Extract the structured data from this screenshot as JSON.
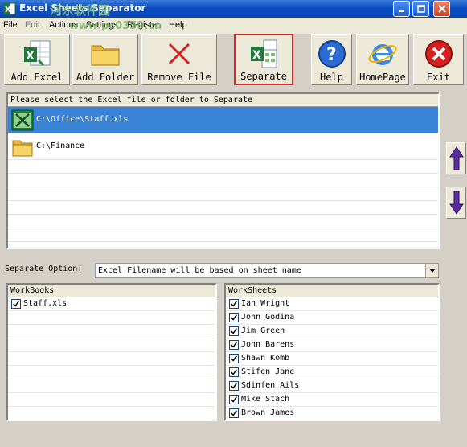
{
  "window": {
    "title": "Excel Sheets Separator"
  },
  "watermark": {
    "text": "www.pc0359.cn"
  },
  "menu": [
    "File",
    "Edit",
    "Actions",
    "Settings",
    "Register",
    "Help"
  ],
  "toolbar": [
    {
      "label": "Add Excel",
      "icon": "add-excel-icon"
    },
    {
      "label": "Add Folder",
      "icon": "folder-icon"
    },
    {
      "label": "Remove File",
      "icon": "remove-x-icon"
    },
    {
      "label": "Separate",
      "icon": "separate-icon"
    },
    {
      "label": "Help",
      "icon": "help-icon"
    },
    {
      "label": "HomePage",
      "icon": "internet-explorer-icon"
    },
    {
      "label": "Exit",
      "icon": "exit-icon"
    }
  ],
  "file_list": {
    "header": "Please select the Excel file or folder to Separate",
    "items": [
      {
        "path": "C:\\Office\\Staff.xls",
        "type": "excel-file",
        "selected": true
      },
      {
        "path": "C:\\Finance",
        "type": "folder",
        "selected": false
      }
    ]
  },
  "separate_option": {
    "label": "Separate Option:",
    "value": "Excel Filename will be based on sheet name"
  },
  "workbooks": {
    "header": "WorkBooks",
    "items": [
      {
        "name": "Staff.xls",
        "checked": true
      }
    ]
  },
  "worksheets": {
    "header": "WorkSheets",
    "items": [
      {
        "name": "Ian Wright",
        "checked": true
      },
      {
        "name": "John Godina",
        "checked": true
      },
      {
        "name": "Jim Green",
        "checked": true
      },
      {
        "name": "John Barens",
        "checked": true
      },
      {
        "name": "Shawn Komb",
        "checked": true
      },
      {
        "name": "Stifen Jane",
        "checked": true
      },
      {
        "name": "Sdinfen Ails",
        "checked": true
      },
      {
        "name": "Mike Stach",
        "checked": true
      },
      {
        "name": "Brown James",
        "checked": true
      }
    ]
  },
  "colors": {
    "titlebar": "#0a4fc2",
    "selection": "#3a84d8",
    "highlight_border": "#d22b2b"
  }
}
